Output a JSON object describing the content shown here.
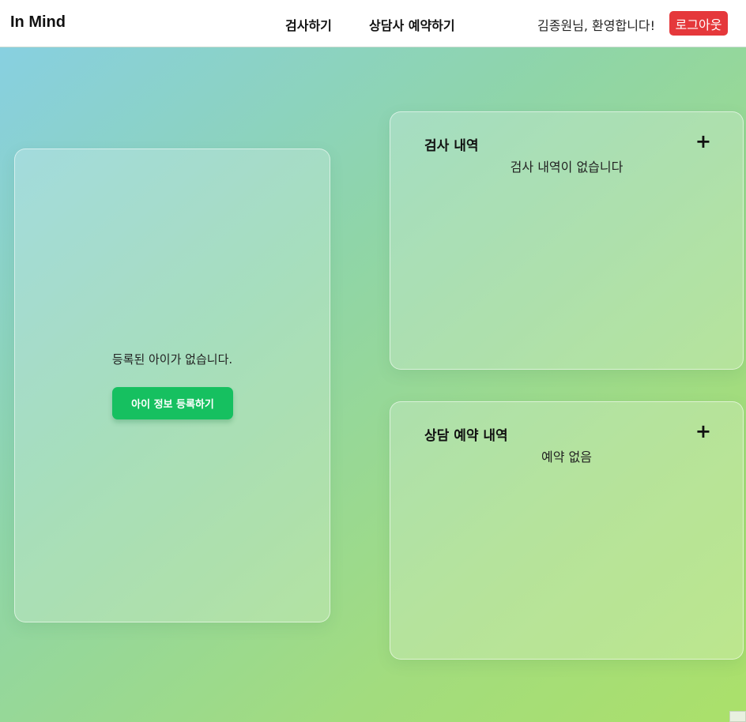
{
  "header": {
    "brand": "In Mind",
    "nav": {
      "test": "검사하기",
      "booking": "상담사 예약하기"
    },
    "welcome": "김종원님, 환영합니다!",
    "logout": "로그아웃"
  },
  "child_panel": {
    "empty_text": "등록된 아이가 없습니다.",
    "register_button": "아이 정보 등록하기"
  },
  "test_history": {
    "title": "검사 내역",
    "add": "+",
    "empty_text": "검사 내역이 없습니다"
  },
  "booking_history": {
    "title": "상담 예약 내역",
    "add": "+",
    "empty_text": "예약 없음"
  },
  "colors": {
    "logout": "#e5383b",
    "register": "#16c060"
  }
}
